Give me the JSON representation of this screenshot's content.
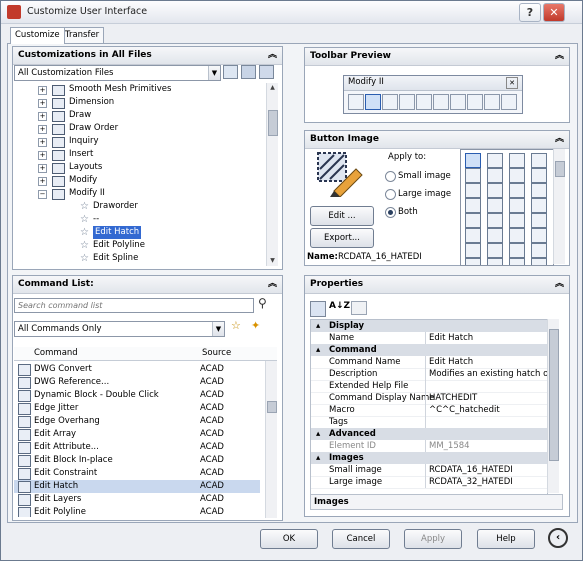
{
  "window": {
    "title": "Customize User Interface"
  },
  "tabs": [
    "Customize",
    "Transfer"
  ],
  "customizations": {
    "header": "Customizations in All Files",
    "filter": "All Customization Files",
    "tree": [
      {
        "label": "Smooth Mesh Primitives",
        "level": 1,
        "type": "toolbar"
      },
      {
        "label": "Dimension",
        "level": 1,
        "type": "toolbar"
      },
      {
        "label": "Draw",
        "level": 1,
        "type": "toolbar"
      },
      {
        "label": "Draw Order",
        "level": 1,
        "type": "toolbar"
      },
      {
        "label": "Inquiry",
        "level": 1,
        "type": "toolbar"
      },
      {
        "label": "Insert",
        "level": 1,
        "type": "toolbar"
      },
      {
        "label": "Layouts",
        "level": 1,
        "type": "toolbar"
      },
      {
        "label": "Modify",
        "level": 1,
        "type": "toolbar"
      },
      {
        "label": "Modify II",
        "level": 1,
        "type": "toolbar",
        "expanded": true
      },
      {
        "label": "Draworder",
        "level": 2,
        "type": "command"
      },
      {
        "label": "--",
        "level": 2,
        "type": "command"
      },
      {
        "label": "Edit Hatch",
        "level": 2,
        "type": "command",
        "selected": true
      },
      {
        "label": "Edit Polyline",
        "level": 2,
        "type": "command"
      },
      {
        "label": "Edit Spline",
        "level": 2,
        "type": "command"
      }
    ]
  },
  "command_list": {
    "header": "Command List:",
    "search_placeholder": "Search command list",
    "filter": "All Commands Only",
    "columns": [
      "Command",
      "Source"
    ],
    "rows": [
      {
        "command": "DWG Convert",
        "source": "ACAD"
      },
      {
        "command": "DWG Reference...",
        "source": "ACAD"
      },
      {
        "command": "Dynamic Block - Double Click",
        "source": "ACAD"
      },
      {
        "command": "Edge Jitter",
        "source": "ACAD"
      },
      {
        "command": "Edge Overhang",
        "source": "ACAD"
      },
      {
        "command": "Edit Array",
        "source": "ACAD"
      },
      {
        "command": "Edit Attribute...",
        "source": "ACAD"
      },
      {
        "command": "Edit Block In-place",
        "source": "ACAD"
      },
      {
        "command": "Edit Constraint",
        "source": "ACAD"
      },
      {
        "command": "Edit Hatch",
        "source": "ACAD",
        "selected": true
      },
      {
        "command": "Edit Layers",
        "source": "ACAD"
      },
      {
        "command": "Edit Polyline",
        "source": "ACAD"
      }
    ]
  },
  "toolbar_preview": {
    "header": "Toolbar Preview",
    "toolbar_title": "Modify II",
    "close": "✕"
  },
  "button_image": {
    "header": "Button Image",
    "apply_to": "Apply to:",
    "options": [
      "Small image",
      "Large image",
      "Both"
    ],
    "selected_option": "Both",
    "edit": "Edit ...",
    "export": "Export...",
    "name_label": "Name:",
    "name_value": "RCDATA_16_HATEDI"
  },
  "properties": {
    "header": "Properties",
    "rows": [
      {
        "kind": "category",
        "name": "Display"
      },
      {
        "kind": "prop",
        "name": "Name",
        "value": "Edit Hatch"
      },
      {
        "kind": "category",
        "name": "Command"
      },
      {
        "kind": "prop",
        "name": "Command Name",
        "value": "Edit Hatch"
      },
      {
        "kind": "prop",
        "name": "Description",
        "value": "Modifies an existing hatch obje"
      },
      {
        "kind": "prop",
        "name": "Extended Help File",
        "value": ""
      },
      {
        "kind": "prop",
        "name": "Command Display Name",
        "value": "HATCHEDIT"
      },
      {
        "kind": "prop",
        "name": "Macro",
        "value": "^C^C_hatchedit"
      },
      {
        "kind": "prop",
        "name": "Tags",
        "value": ""
      },
      {
        "kind": "category",
        "name": "Advanced"
      },
      {
        "kind": "prop",
        "name": "Element ID",
        "value": "MM_1584",
        "muted": true
      },
      {
        "kind": "category",
        "name": "Images"
      },
      {
        "kind": "prop",
        "name": "Small image",
        "value": "RCDATA_16_HATEDI"
      },
      {
        "kind": "prop",
        "name": "Large image",
        "value": "RCDATA_32_HATEDI"
      }
    ],
    "footer": "Images"
  },
  "buttons": {
    "ok": "OK",
    "cancel": "Cancel",
    "apply": "Apply",
    "help": "Help"
  },
  "icons": [
    "help-icon",
    "close-icon",
    "search-icon",
    "save-icon",
    "load-icon",
    "star-icon"
  ]
}
